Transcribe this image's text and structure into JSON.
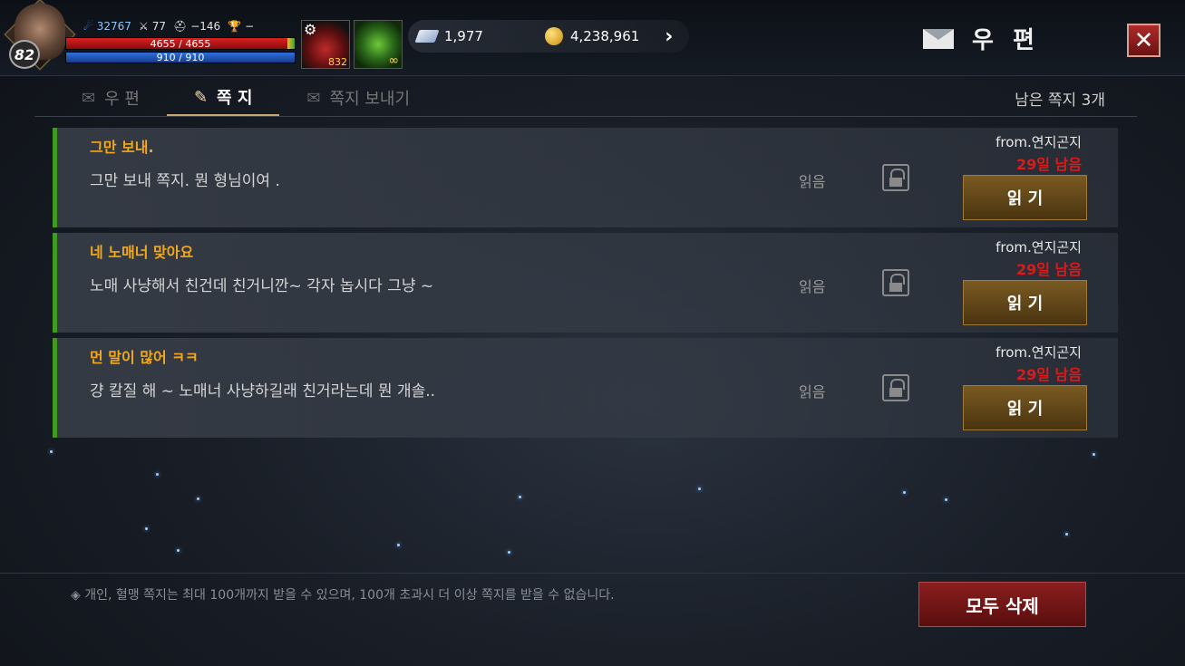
{
  "player": {
    "level": "82",
    "combat_power": "32767",
    "attack": "77",
    "defense": "−146",
    "rank": "−",
    "hp": "4655 / 4655",
    "mp": "910 / 910",
    "icons": {
      "portrait": "hero-portrait",
      "power": "flame-icon",
      "attack": "sword-icon",
      "defense": "helmet-icon",
      "rank": "trophy-icon"
    }
  },
  "items": {
    "potion_count": "832",
    "leaf_count": "∞"
  },
  "currency": {
    "diamonds": "1,977",
    "gold": "4,238,961"
  },
  "header": {
    "title": "우 편",
    "close": "✕"
  },
  "tabs": [
    {
      "label": "우 편",
      "icon": "scroll-icon"
    },
    {
      "label": "쪽 지",
      "icon": "note-icon"
    },
    {
      "label": "쪽지 보내기",
      "icon": "send-mail-icon"
    }
  ],
  "remaining": "남은 쪽지 3개",
  "messages": [
    {
      "title": "그만 보내.",
      "body": "그만 보내 쪽지. 뭔 형님이여 .",
      "status": "읽음",
      "from": "from.연지곤지",
      "days": "29일 남음",
      "button": "읽 기"
    },
    {
      "title": "네 노매너 맞아요",
      "body": "노매 사냥해서 친건데 친거니깐~  각자 놉시다 그냥 ~",
      "status": "읽음",
      "from": "from.연지곤지",
      "days": "29일 남음",
      "button": "읽 기"
    },
    {
      "title": "먼 말이 많어 ㅋㅋ",
      "body": "걍 칼질 해 ~  노매너 사냥하길래 친거라는데 뭔 개솔..",
      "status": "읽음",
      "from": "from.연지곤지",
      "days": "29일 남음",
      "button": "읽 기"
    }
  ],
  "footer": {
    "note": "◈ 개인, 혈맹 쪽지는 최대 100개까지 받을 수 있으며, 100개 초과시 더 이상 쪽지를 받을 수 없습니다.",
    "delete_all": "모두 삭제"
  },
  "colors": {
    "accent_gold": "#f2a81c",
    "days_red": "#e01818",
    "read_bar_green": "#3f9a1e"
  }
}
